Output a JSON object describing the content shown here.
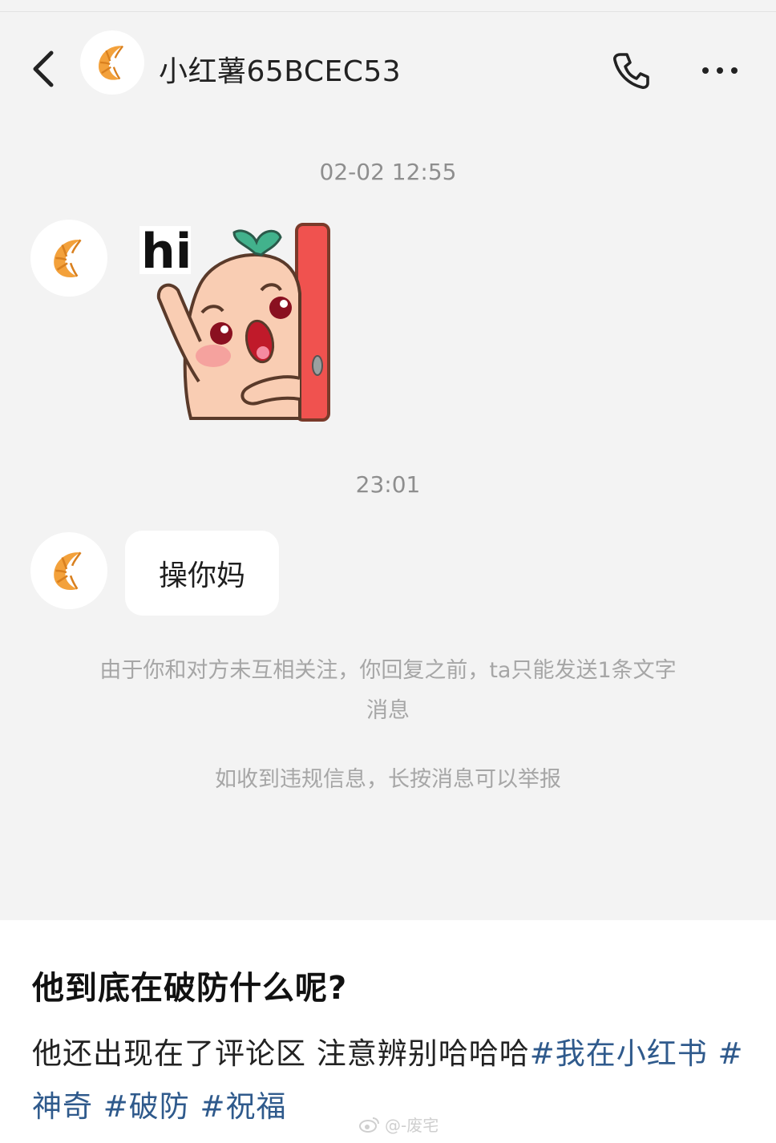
{
  "header": {
    "contact_name": "小红薯65BCEC53",
    "back_icon": "chevron-left-icon",
    "phone_icon": "phone-icon",
    "more_icon": "more-horizontal-icon",
    "avatar_icon": "croissant-icon"
  },
  "messages": [
    {
      "timestamp": "02-02 12:55",
      "type": "sticker",
      "sticker_text": "hi"
    },
    {
      "timestamp": "23:01",
      "type": "text",
      "text": "操你妈"
    }
  ],
  "system_notes": {
    "follow_limit_line1": "由于你和对方未互相关注，你回复之前，ta只能发送1条文字",
    "follow_limit_line2": "消息",
    "report_hint": "如收到违规信息，长按消息可以举报"
  },
  "post": {
    "title": "他到底在破防什么呢?",
    "body": "他还出现在了评论区 注意辨别哈哈哈",
    "tags": [
      "#我在小红书",
      "#神奇",
      "#破防",
      "#祝福"
    ]
  },
  "watermark": "@-废宅",
  "colors": {
    "chat_background": "#f3f3f3",
    "tag_color": "#2f5a8c",
    "timestamp_color": "#8e8e8e",
    "sticker_door_red": "#f0524f"
  }
}
